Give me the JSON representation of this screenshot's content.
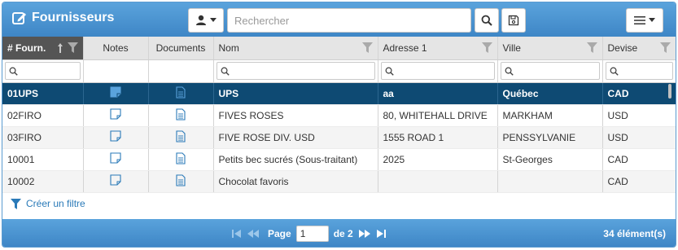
{
  "header": {
    "title": "Fournisseurs",
    "search_placeholder": "Rechercher",
    "user_menu_icon": "user-icon",
    "search_icon": "search-icon",
    "save_icon": "save-icon",
    "menu_icon": "hamburger-menu-icon"
  },
  "columns": [
    {
      "label": "# Fourn."
    },
    {
      "label": "Notes"
    },
    {
      "label": "Documents"
    },
    {
      "label": "Nom"
    },
    {
      "label": "Adresse 1"
    },
    {
      "label": "Ville"
    },
    {
      "label": "Devise"
    }
  ],
  "rows": [
    {
      "code": "01UPS",
      "nom": "UPS",
      "adresse": "aa",
      "ville": "Québec",
      "devise": "CAD",
      "selected": true
    },
    {
      "code": "02FIRO",
      "nom": "FIVES ROSES",
      "adresse": "80, WHITEHALL DRIVE",
      "ville": "MARKHAM",
      "devise": "USD"
    },
    {
      "code": "03FIRO",
      "nom": "FIVE ROSE DIV. USD",
      "adresse": "1555 ROAD 1",
      "ville": "PENSSYLVANIE",
      "devise": "USD"
    },
    {
      "code": "10001",
      "nom": "Petits bec sucrés (Sous-traitant)",
      "adresse": "2025",
      "ville": "St-Georges",
      "devise": "CAD"
    },
    {
      "code": "10002",
      "nom": "Chocolat favoris",
      "adresse": "",
      "ville": "",
      "devise": "CAD"
    }
  ],
  "footer": {
    "create_filter": "Créer un filtre"
  },
  "pager": {
    "page_label": "Page",
    "current_page": "1",
    "of_label": "de 2",
    "count": "34 élément(s)"
  },
  "colors": {
    "header_blue": "#3e86c6",
    "selected_row": "#0e4a73",
    "link_blue": "#2a7ab8"
  }
}
